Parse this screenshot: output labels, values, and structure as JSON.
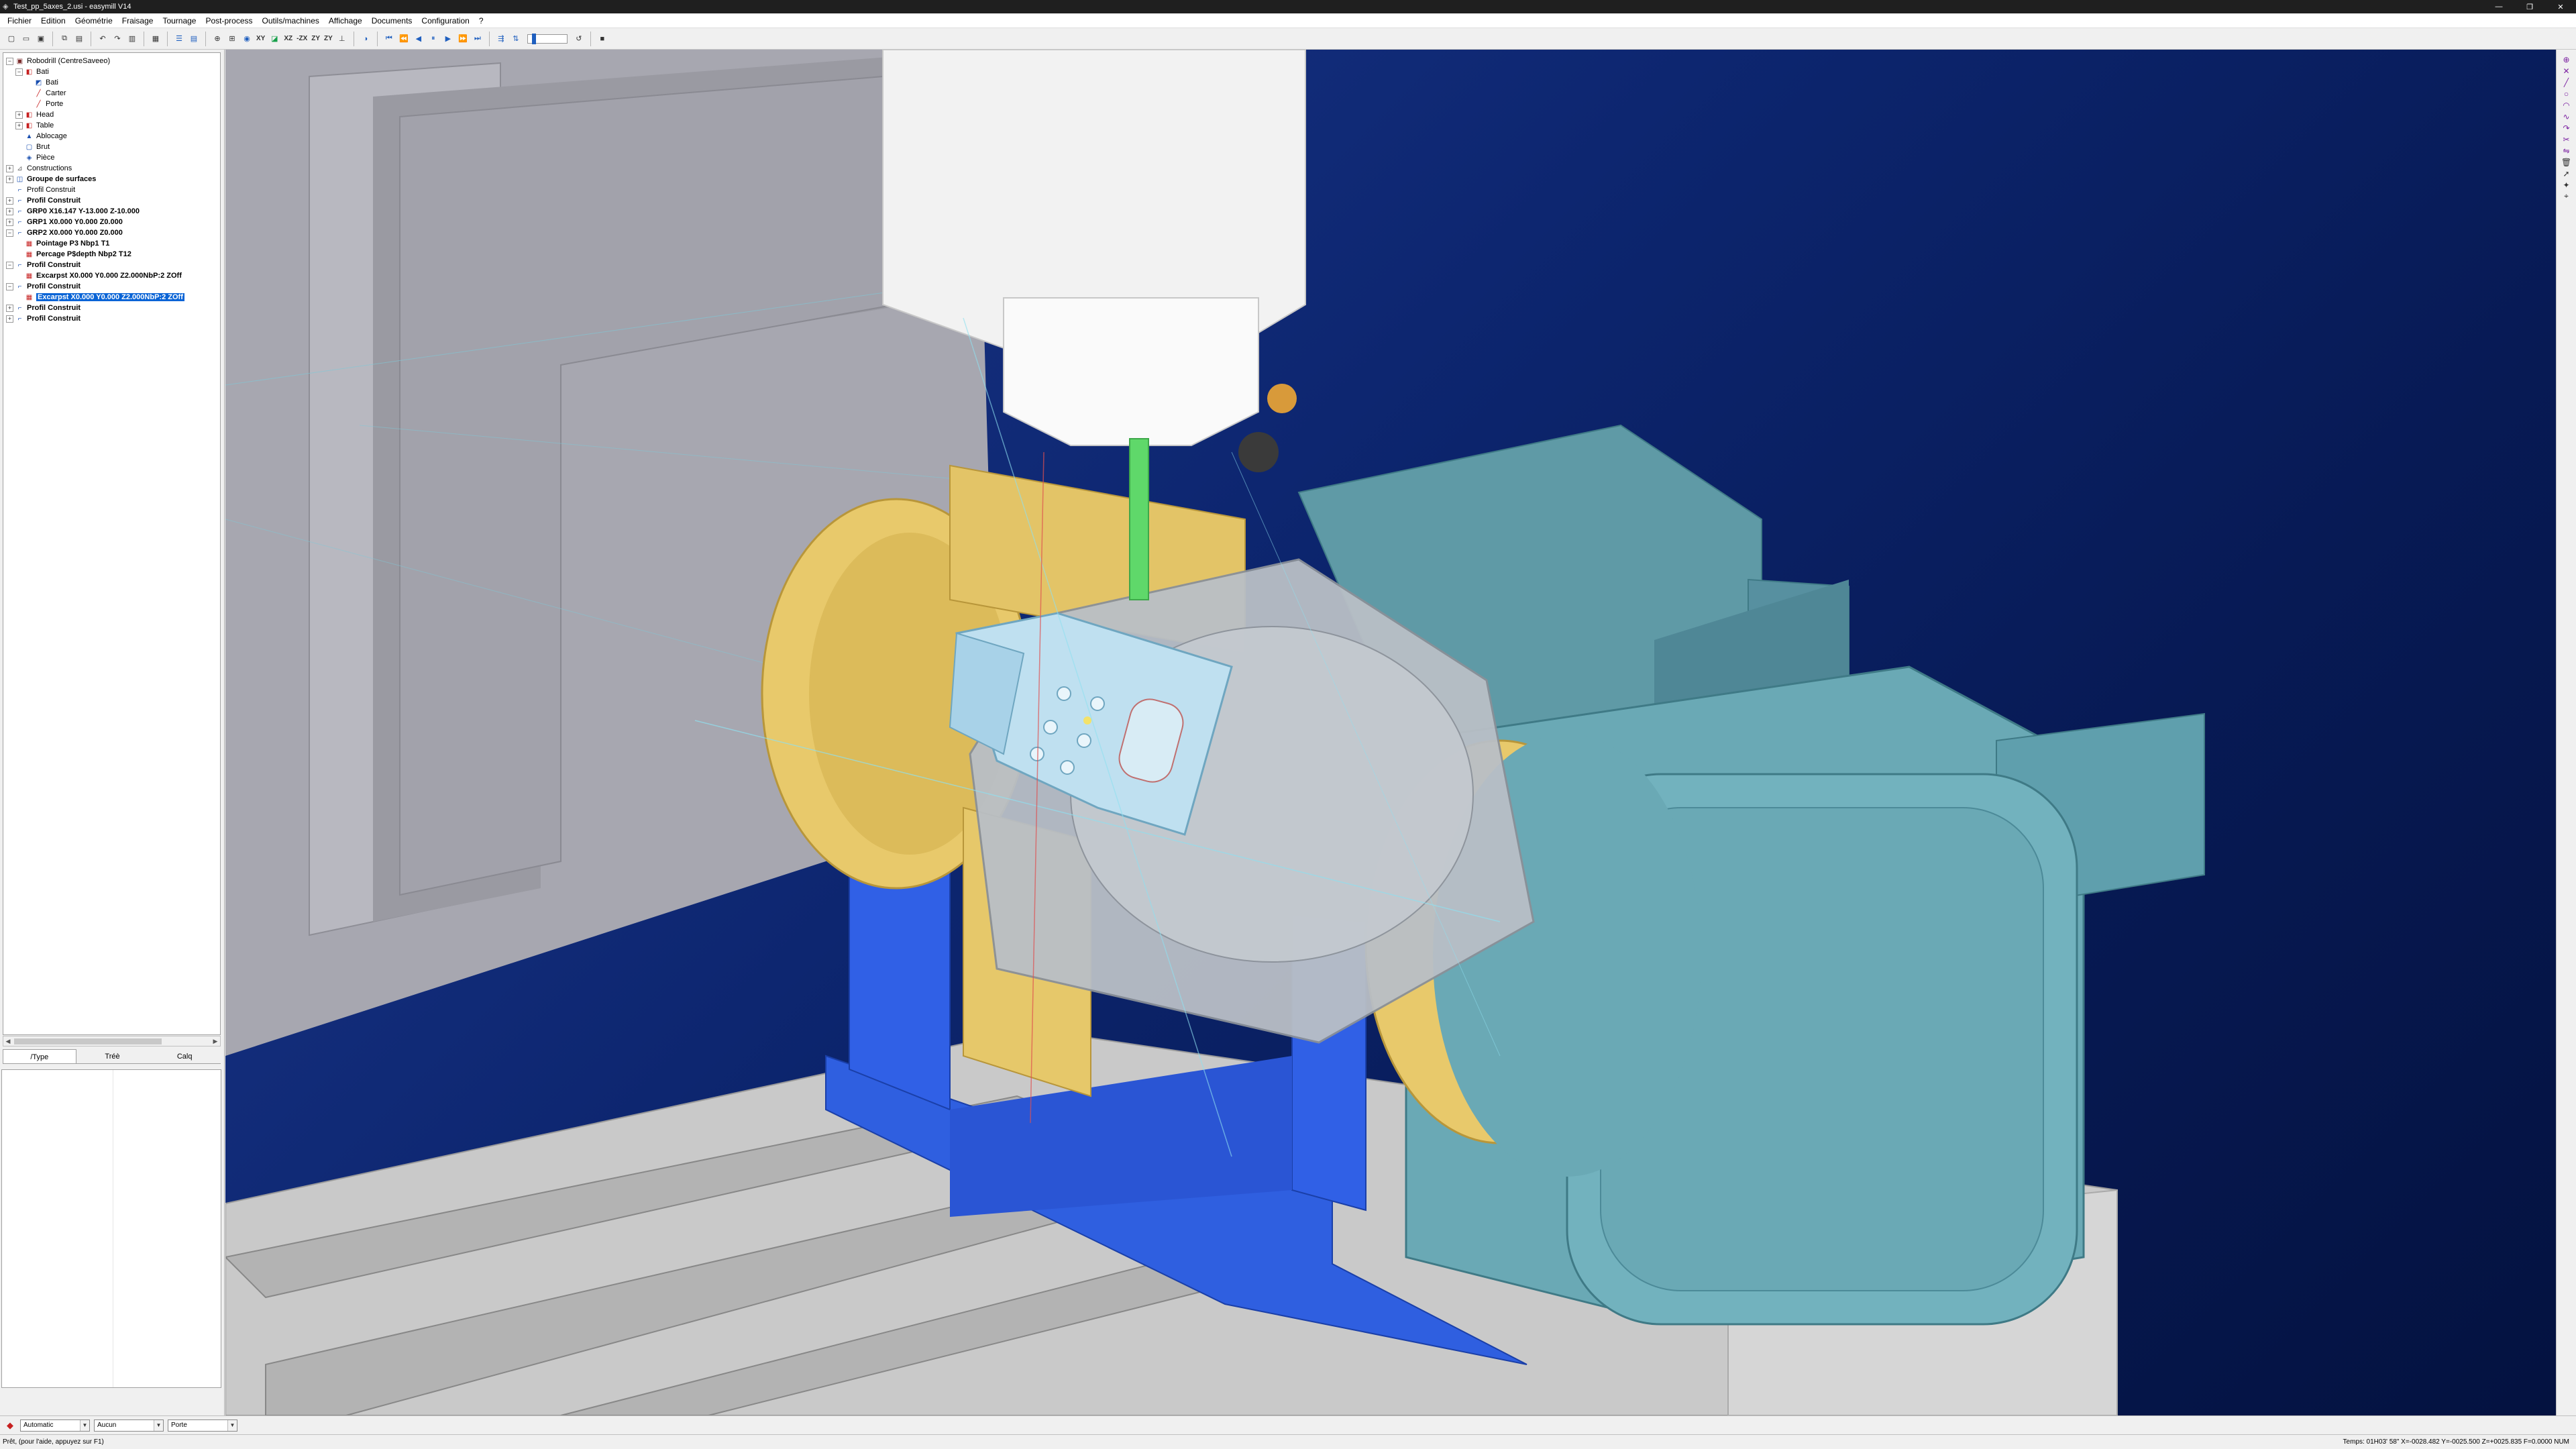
{
  "window": {
    "title": "Test_pp_5axes_2.usi - easymill V14",
    "buttons": [
      "—",
      "❐",
      "✕"
    ]
  },
  "menu": [
    "Fichier",
    "Edition",
    "Géométrie",
    "Fraisage",
    "Tournage",
    "Post-process",
    "Outils/machines",
    "Affichage",
    "Documents",
    "Configuration",
    "?"
  ],
  "toolbar": {
    "view_labels": [
      "XY",
      "XZ",
      "-ZX",
      "ZY",
      "ZY"
    ]
  },
  "tree": [
    {
      "label": "Robodrill (CentreSaveeo)",
      "depth": 0,
      "exp": "−",
      "icon": "machine-icon",
      "glyph": "▣",
      "color": "mach"
    },
    {
      "label": "Bati",
      "depth": 1,
      "exp": "−",
      "icon": "frame-icon",
      "glyph": "◧",
      "color": "red"
    },
    {
      "label": "Bati",
      "depth": 2,
      "exp": "",
      "icon": "part-icon",
      "glyph": "◩",
      "color": "blue"
    },
    {
      "label": "Carter",
      "depth": 2,
      "exp": "",
      "icon": "line-icon",
      "glyph": "╱",
      "color": "red"
    },
    {
      "label": "Porte",
      "depth": 2,
      "exp": "",
      "icon": "line-icon",
      "glyph": "╱",
      "color": "red"
    },
    {
      "label": "Head",
      "depth": 1,
      "exp": "+",
      "icon": "head-icon",
      "glyph": "◧",
      "color": "red"
    },
    {
      "label": "Table",
      "depth": 1,
      "exp": "+",
      "icon": "table-icon",
      "glyph": "◧",
      "color": "red"
    },
    {
      "label": "Ablocage",
      "depth": 1,
      "exp": "",
      "icon": "fixture-icon",
      "glyph": "▲",
      "color": "blue"
    },
    {
      "label": "Brut",
      "depth": 1,
      "exp": "",
      "icon": "stock-icon",
      "glyph": "▢",
      "color": "blue"
    },
    {
      "label": "Pièce",
      "depth": 1,
      "exp": "",
      "icon": "part-icon",
      "glyph": "◈",
      "color": "blue"
    },
    {
      "label": "Constructions",
      "depth": 0,
      "exp": "+",
      "icon": "construction-icon",
      "glyph": "⊿",
      "color": "gray"
    },
    {
      "label": "Groupe de surfaces",
      "depth": 0,
      "exp": "+",
      "icon": "surface-group-icon",
      "glyph": "◫",
      "color": "blue",
      "bold": true
    },
    {
      "label": "Profil Construit",
      "depth": 0,
      "exp": "",
      "icon": "profile-icon",
      "glyph": "⌐",
      "color": "blue"
    },
    {
      "label": "Profil Construit",
      "depth": 0,
      "exp": "+",
      "icon": "profile-icon",
      "glyph": "⌐",
      "color": "blue",
      "bold": true
    },
    {
      "label": "GRP0 X16.147 Y-13.000 Z-10.000",
      "depth": 0,
      "exp": "+",
      "icon": "group-icon",
      "glyph": "⌐",
      "color": "blue",
      "bold": true
    },
    {
      "label": "GRP1 X0.000 Y0.000 Z0.000",
      "depth": 0,
      "exp": "+",
      "icon": "group-icon",
      "glyph": "⌐",
      "color": "blue",
      "bold": true
    },
    {
      "label": "GRP2 X0.000 Y0.000 Z0.000",
      "depth": 0,
      "exp": "−",
      "icon": "group-icon",
      "glyph": "⌐",
      "color": "blue",
      "bold": true
    },
    {
      "label": "Pointage P3 Nbp1 T1",
      "depth": 1,
      "exp": "",
      "icon": "operation-icon",
      "glyph": "▦",
      "color": "red",
      "bold": true
    },
    {
      "label": "Percage P$depth Nbp2 T12",
      "depth": 1,
      "exp": "",
      "icon": "operation-icon",
      "glyph": "▦",
      "color": "red",
      "bold": true
    },
    {
      "label": "Profil Construit",
      "depth": 0,
      "exp": "−",
      "icon": "profile-icon",
      "glyph": "⌐",
      "color": "blue",
      "bold": true
    },
    {
      "label": "Excarpst X0.000 Y0.000 Z2.000NbP:2 ZOff",
      "depth": 1,
      "exp": "",
      "icon": "operation-icon",
      "glyph": "▦",
      "color": "red",
      "bold": true
    },
    {
      "label": "Profil Construit",
      "depth": 0,
      "exp": "−",
      "icon": "profile-icon",
      "glyph": "⌐",
      "color": "blue",
      "bold": true
    },
    {
      "label": "Excarpst X0.000 Y0.000 Z2.000NbP:2 ZOff",
      "depth": 1,
      "exp": "",
      "icon": "operation-icon",
      "glyph": "▦",
      "color": "red",
      "bold": true,
      "selected": true
    },
    {
      "label": "Profil Construit",
      "depth": 0,
      "exp": "+",
      "icon": "profile-icon",
      "glyph": "⌐",
      "color": "blue",
      "bold": true
    },
    {
      "label": "Profil Construit",
      "depth": 0,
      "exp": "+",
      "icon": "profile-icon",
      "glyph": "⌐",
      "color": "blue",
      "bold": true
    }
  ],
  "tabs": [
    "/Type",
    "Tréè",
    "Calq"
  ],
  "modebar": {
    "mode": "Automatic",
    "filter": "Aucun",
    "post": "Porte"
  },
  "status": {
    "message": "Prêt, (pour l'aide, appuyez sur F1)",
    "coords": "Temps: 01H03' 58\"  X=-0028.482 Y=-0025.500 Z=+0025.835 F=0.0000   NUM"
  },
  "colors": {
    "background_top": "#1e3a8f",
    "background_bottom": "#041240",
    "enclosure": "#a9a9b1",
    "spindle": "#f2f2f2",
    "tool": "#5fd86a",
    "trunnion_gold": "#e8c96b",
    "base_blue": "#2f5fe0",
    "motor_teal": "#6aa9b5",
    "table_gray": "#c9c9c9",
    "part": "#bfe0f0"
  }
}
